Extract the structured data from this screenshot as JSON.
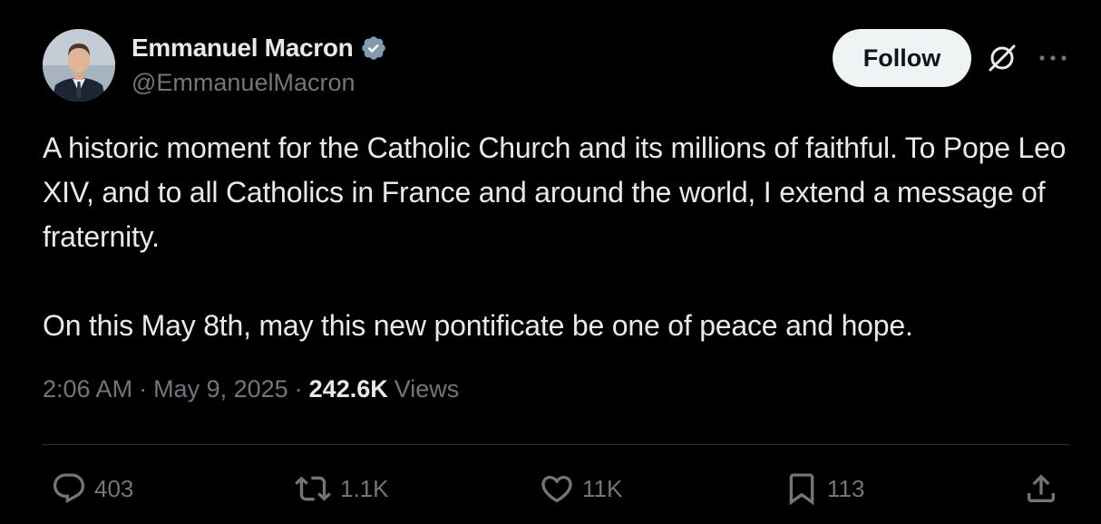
{
  "author": {
    "display_name": "Emmanuel Macron",
    "handle": "@EmmanuelMacron",
    "verified": true,
    "verified_color": "#829aab"
  },
  "header": {
    "follow_label": "Follow"
  },
  "tweet": {
    "paragraphs": [
      "A historic moment for the Catholic Church and its millions of faithful. To Pope Leo XIV, and to all Catholics in France and around the world, I extend a message of fraternity.",
      "On this May 8th, may this new pontificate be one of peace and hope."
    ]
  },
  "meta": {
    "time": "2:06 AM",
    "date": "May 9, 2025",
    "views_count": "242.6K",
    "views_label": "Views",
    "separator": "·"
  },
  "actions": {
    "replies": "403",
    "reposts": "1.1K",
    "likes": "11K",
    "bookmarks": "113"
  },
  "colors": {
    "background": "#000000",
    "text_primary": "#e7e9ea",
    "text_secondary": "#71767b",
    "divider": "#2f3336",
    "follow_bg": "#eff3f4"
  }
}
